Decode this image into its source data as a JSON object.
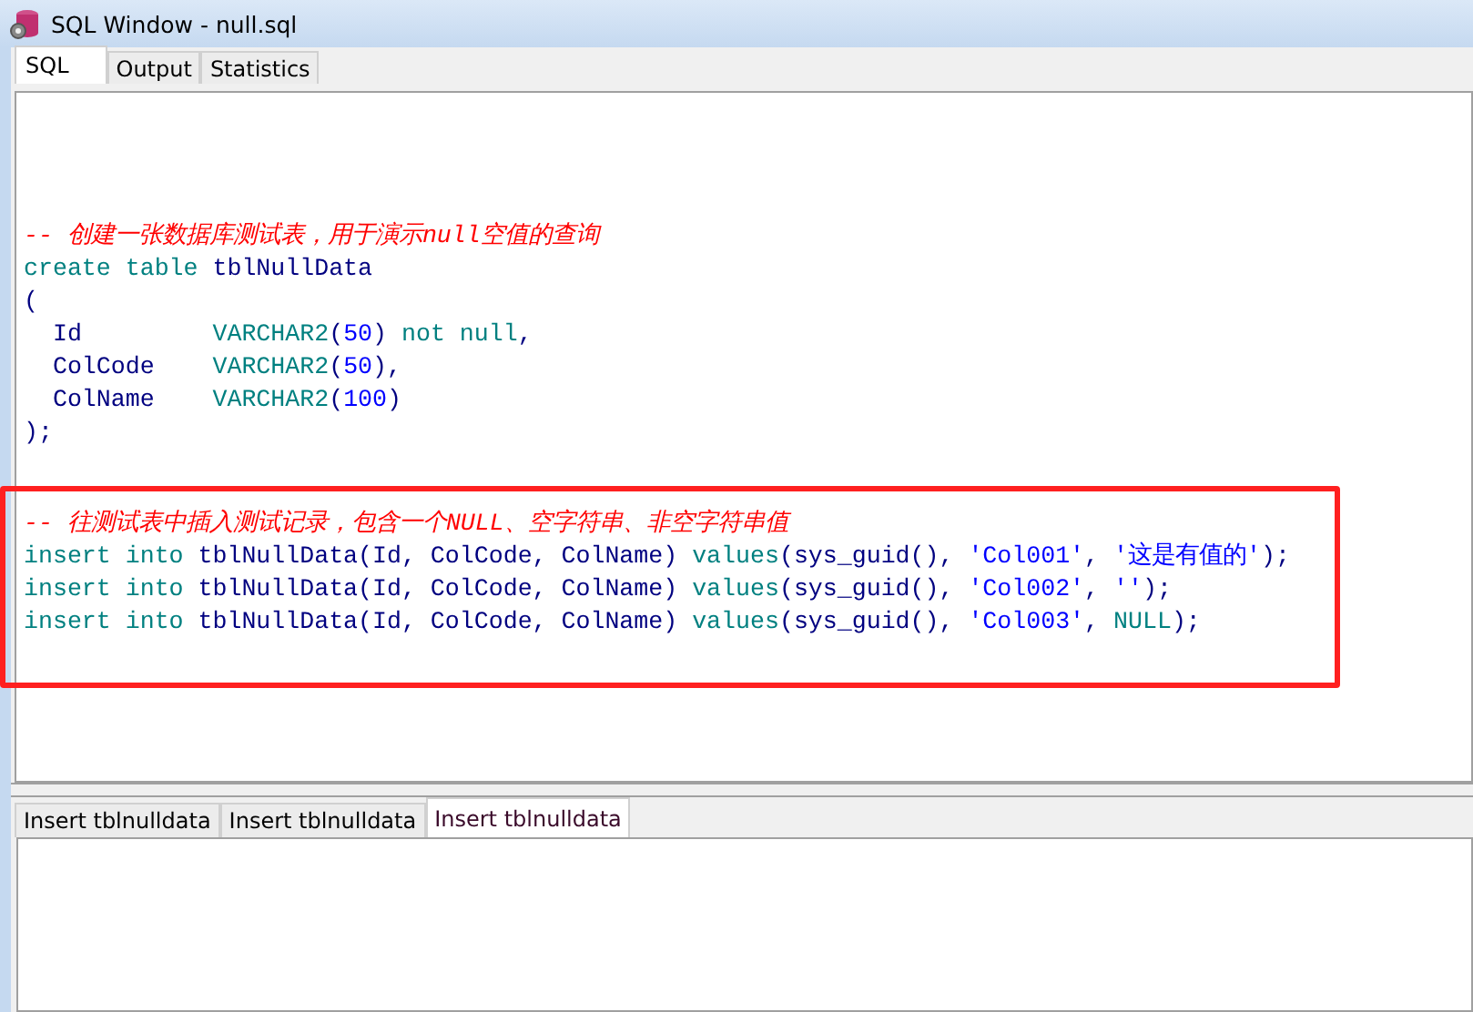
{
  "window": {
    "title": "SQL Window - null.sql"
  },
  "tabs": [
    {
      "label": "SQL",
      "selected": true
    },
    {
      "label": "Output",
      "selected": false
    },
    {
      "label": "Statistics",
      "selected": false
    }
  ],
  "editor": {
    "blocks": [
      {
        "highlighted": false,
        "lines": [
          [
            {
              "kind": "comment",
              "text": "-- 创建一张数据库测试表，用于演示null空值的查询"
            }
          ],
          [
            {
              "kind": "keyword",
              "text": "create table "
            },
            {
              "kind": "ident",
              "text": "tblNullData"
            }
          ],
          [
            {
              "kind": "ident",
              "text": "("
            }
          ],
          [
            {
              "kind": "ident",
              "text": "  Id         "
            },
            {
              "kind": "keyword",
              "text": "VARCHAR2"
            },
            {
              "kind": "ident",
              "text": "("
            },
            {
              "kind": "number",
              "text": "50"
            },
            {
              "kind": "ident",
              "text": ") "
            },
            {
              "kind": "keyword",
              "text": "not null"
            },
            {
              "kind": "ident",
              "text": ","
            }
          ],
          [
            {
              "kind": "ident",
              "text": "  ColCode    "
            },
            {
              "kind": "keyword",
              "text": "VARCHAR2"
            },
            {
              "kind": "ident",
              "text": "("
            },
            {
              "kind": "number",
              "text": "50"
            },
            {
              "kind": "ident",
              "text": "),"
            }
          ],
          [
            {
              "kind": "ident",
              "text": "  ColName    "
            },
            {
              "kind": "keyword",
              "text": "VARCHAR2"
            },
            {
              "kind": "ident",
              "text": "("
            },
            {
              "kind": "number",
              "text": "100"
            },
            {
              "kind": "ident",
              "text": ")"
            }
          ],
          [
            {
              "kind": "ident",
              "text": ");"
            }
          ]
        ]
      },
      {
        "highlighted": true,
        "lines": [
          [
            {
              "kind": "comment",
              "text": "-- 往测试表中插入测试记录，包含一个NULL、空字符串、非空字符串值"
            }
          ],
          [
            {
              "kind": "keyword",
              "text": "insert into "
            },
            {
              "kind": "ident",
              "text": "tblNullData(Id, ColCode, ColName) "
            },
            {
              "kind": "keyword",
              "text": "values"
            },
            {
              "kind": "ident",
              "text": "(sys_guid(), "
            },
            {
              "kind": "string",
              "text": "'Col001'"
            },
            {
              "kind": "ident",
              "text": ", "
            },
            {
              "kind": "string",
              "text": "'这是有值的'"
            },
            {
              "kind": "ident",
              "text": ");"
            }
          ],
          [
            {
              "kind": "keyword",
              "text": "insert into "
            },
            {
              "kind": "ident",
              "text": "tblNullData(Id, ColCode, ColName) "
            },
            {
              "kind": "keyword",
              "text": "values"
            },
            {
              "kind": "ident",
              "text": "(sys_guid(), "
            },
            {
              "kind": "string",
              "text": "'Col002'"
            },
            {
              "kind": "ident",
              "text": ", "
            },
            {
              "kind": "string",
              "text": "''"
            },
            {
              "kind": "ident",
              "text": ");"
            }
          ],
          [
            {
              "kind": "keyword",
              "text": "insert into "
            },
            {
              "kind": "ident",
              "text": "tblNullData(Id, ColCode, ColName) "
            },
            {
              "kind": "keyword",
              "text": "values"
            },
            {
              "kind": "ident",
              "text": "(sys_guid(), "
            },
            {
              "kind": "string",
              "text": "'Col003'"
            },
            {
              "kind": "ident",
              "text": ", "
            },
            {
              "kind": "keyword",
              "text": "NULL"
            },
            {
              "kind": "ident",
              "text": ");"
            }
          ]
        ]
      }
    ]
  },
  "result_tabs": [
    {
      "label": "Insert tblnulldata",
      "selected": false
    },
    {
      "label": "Insert tblnulldata",
      "selected": false
    },
    {
      "label": "Insert tblnulldata",
      "selected": true
    }
  ]
}
